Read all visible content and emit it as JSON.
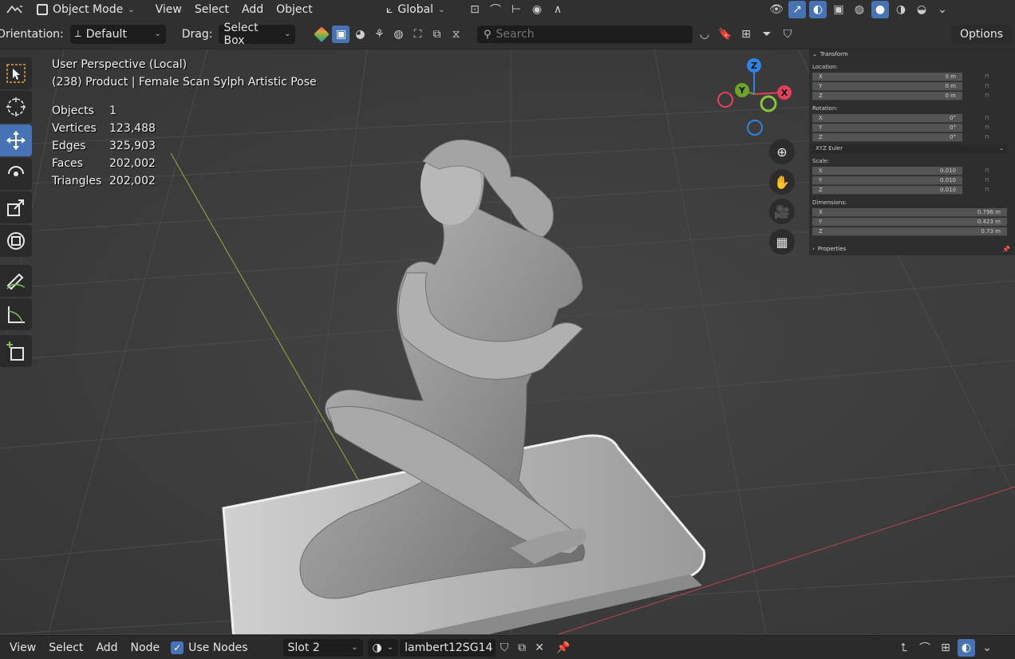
{
  "topbar": {
    "mode": "Object Mode",
    "menus": [
      "View",
      "Select",
      "Add",
      "Object"
    ],
    "transform_orientation": "Global"
  },
  "toolbar2": {
    "orientation_label": "Orientation:",
    "orientation_value": "Default",
    "drag_label": "Drag:",
    "drag_value": "Select Box",
    "search_placeholder": "Search",
    "options_label": "Options"
  },
  "overlay": {
    "view_name": "User Perspective (Local)",
    "object_name": "(238) Product | Female Scan Sylph Artistic Pose",
    "stats": [
      {
        "label": "Objects",
        "value": "1"
      },
      {
        "label": "Vertices",
        "value": "123,488"
      },
      {
        "label": "Edges",
        "value": "325,903"
      },
      {
        "label": "Faces",
        "value": "202,002"
      },
      {
        "label": "Triangles",
        "value": "202,002"
      }
    ]
  },
  "gizmo": {
    "x": "X",
    "y": "Y",
    "z": "Z"
  },
  "npanel": {
    "transform_title": "Transform",
    "location_label": "Location:",
    "location": [
      {
        "axis": "X",
        "value": "0 m"
      },
      {
        "axis": "Y",
        "value": "0 m"
      },
      {
        "axis": "Z",
        "value": "0 m"
      }
    ],
    "rotation_label": "Rotation:",
    "rotation": [
      {
        "axis": "X",
        "value": "0°"
      },
      {
        "axis": "Y",
        "value": "0°"
      },
      {
        "axis": "Z",
        "value": "0°"
      }
    ],
    "rotation_mode": "XYZ Euler",
    "scale_label": "Scale:",
    "scale": [
      {
        "axis": "X",
        "value": "0.010"
      },
      {
        "axis": "Y",
        "value": "0.010"
      },
      {
        "axis": "Z",
        "value": "0.010"
      }
    ],
    "dimensions_label": "Dimensions:",
    "dimensions": [
      {
        "axis": "X",
        "value": "0.796 m"
      },
      {
        "axis": "Y",
        "value": "0.423 m"
      },
      {
        "axis": "Z",
        "value": "0.73 m"
      }
    ],
    "properties_title": "Properties"
  },
  "bottombar": {
    "menus": [
      "View",
      "Select",
      "Add",
      "Node"
    ],
    "use_nodes_label": "Use Nodes",
    "slot": "Slot 2",
    "material": "lambert12SG14"
  },
  "colors": {
    "accent": "#4772b3",
    "axis_x": "#e2405b",
    "axis_y": "#6ea32a",
    "axis_z": "#2f83e3"
  }
}
